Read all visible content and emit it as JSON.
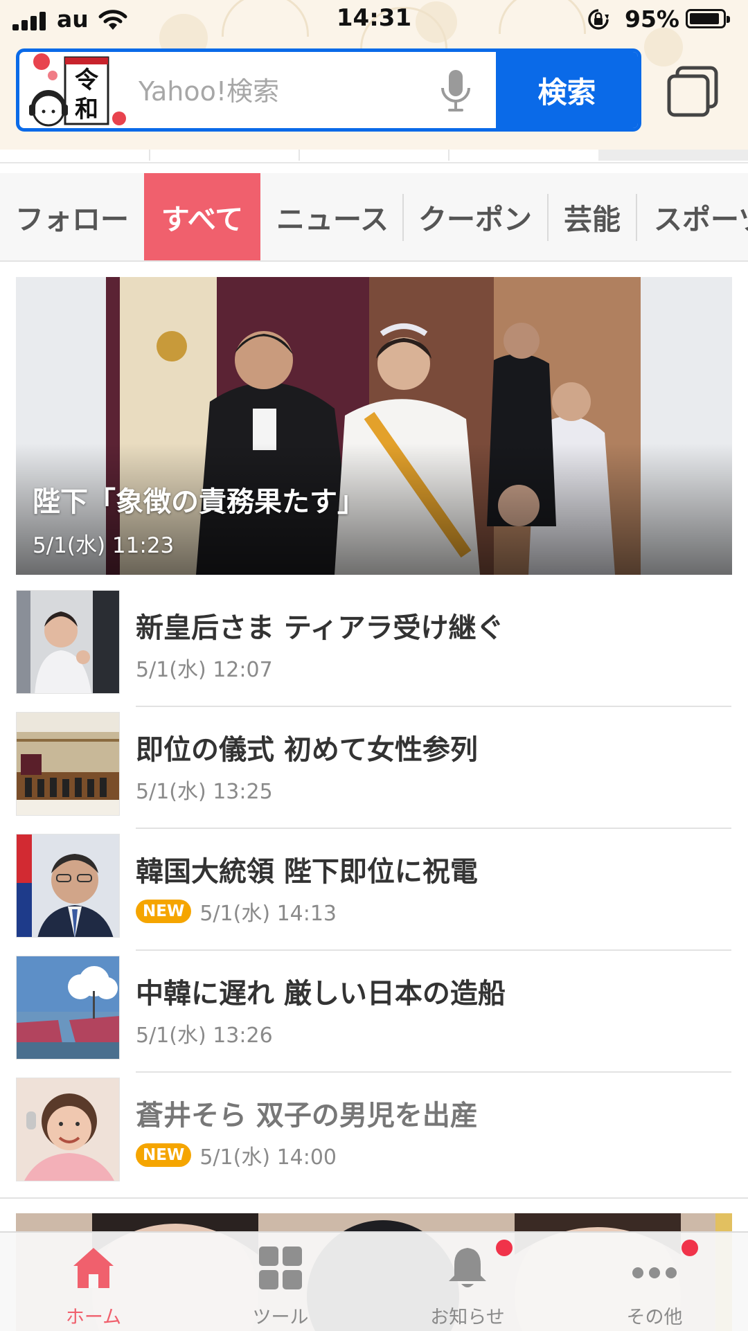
{
  "status_bar": {
    "carrier": "au",
    "time": "14:31",
    "battery_percent": "95%",
    "battery_level": 0.95
  },
  "search": {
    "placeholder": "Yahoo!検索",
    "button_label": "検索",
    "mascot_text_top": "令",
    "mascot_text_bottom": "和"
  },
  "categories": [
    {
      "label": "フォロー",
      "active": false
    },
    {
      "label": "すべて",
      "active": true
    },
    {
      "label": "ニュース",
      "active": false
    },
    {
      "label": "クーポン",
      "active": false
    },
    {
      "label": "芸能",
      "active": false
    },
    {
      "label": "スポーツ",
      "active": false
    }
  ],
  "hero": {
    "title": "陛下「象徴の責務果たす」",
    "date": "5/1(水) 11:23"
  },
  "news": [
    {
      "title": "新皇后さま ティアラ受け継ぐ",
      "date": "5/1(水) 12:07",
      "new": false,
      "badge": ""
    },
    {
      "title": "即位の儀式  初めて女性参列",
      "date": "5/1(水) 13:25",
      "new": false,
      "badge": ""
    },
    {
      "title": "韓国大統領 陛下即位に祝電",
      "date": "5/1(水) 14:13",
      "new": true,
      "badge": "NEW"
    },
    {
      "title": "中韓に遅れ 厳しい日本の造船",
      "date": "5/1(水) 13:26",
      "new": false,
      "badge": ""
    },
    {
      "title": "蒼井そら 双子の男児を出産",
      "date": "5/1(水) 14:00",
      "new": true,
      "badge": "NEW"
    }
  ],
  "bottom_nav": [
    {
      "label": "ホーム",
      "icon": "home-icon",
      "active": true,
      "notification": false
    },
    {
      "label": "ツール",
      "icon": "tools-grid-icon",
      "active": false,
      "notification": false
    },
    {
      "label": "お知らせ",
      "icon": "bell-icon",
      "active": false,
      "notification": true
    },
    {
      "label": "その他",
      "icon": "more-dots-icon",
      "active": false,
      "notification": true
    }
  ],
  "colors": {
    "accent": "#f0606d",
    "search_blue": "#0a6ae8",
    "new_badge": "#f5a500",
    "notification_dot": "#f0334a"
  }
}
